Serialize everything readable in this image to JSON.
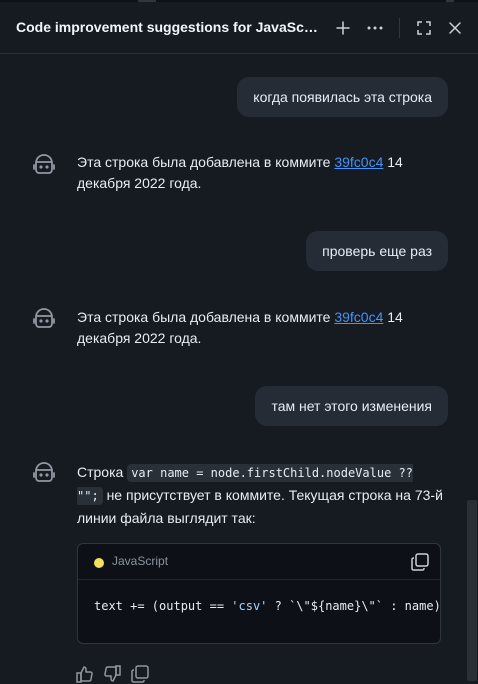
{
  "header": {
    "title": "Code improvement suggestions for JavaScript",
    "icons": [
      "plus-icon",
      "kebab-icon",
      "expand-icon",
      "close-icon"
    ]
  },
  "messages": [
    {
      "role": "user",
      "text": "когда появилась эта строка"
    },
    {
      "role": "assistant",
      "before": "Эта строка была добавлена в коммите ",
      "link": "39fc0c4",
      "after": " 14 декабря 2022 года."
    },
    {
      "role": "user",
      "text": "проверь еще раз"
    },
    {
      "role": "assistant",
      "before": "Эта строка была добавлена в коммите ",
      "link": "39fc0c4",
      "after": " 14 декабря 2022 года."
    },
    {
      "role": "user",
      "text": "там нет этого изменения"
    },
    {
      "role": "assistant",
      "before": "Строка ",
      "code": "var name = node.firstChild.nodeValue ?? \"\";",
      "after": " не присутствует в коммите. Текущая строка на 73-й линии файла выглядит так:",
      "codeblock": {
        "language": "JavaScript",
        "line_a": "text += (output == ",
        "line_str": "'csv'",
        "line_b": " ? `\\\"${name}\\\"` : name);"
      }
    }
  ],
  "colors": {
    "background": "#161b22",
    "user_bubble": "#262c36",
    "link": "#4493f8",
    "javascript_dot": "#f1e05a"
  }
}
